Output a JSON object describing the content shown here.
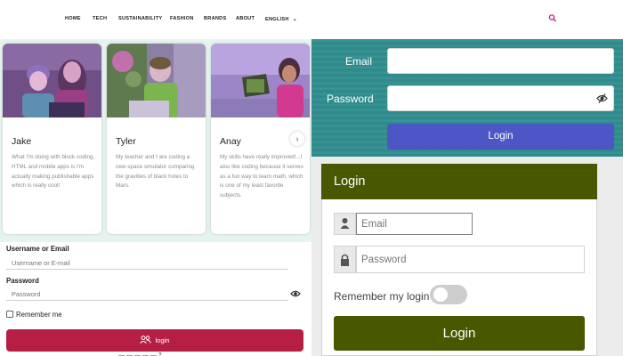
{
  "nav": {
    "links": [
      "HOME",
      "TECH",
      "SUSTAINABILITY",
      "FASHION",
      "BRANDS",
      "ABOUT",
      "ENGLISH"
    ],
    "search_icon": "search-icon",
    "accent_color": "#c0168b"
  },
  "cards": [
    {
      "name": "Jake",
      "quote": "What I'm doing with block coding, HTML and mobile apps is I'm actually making publishable apps which is really cool!"
    },
    {
      "name": "Tyler",
      "quote": "My teacher and I are coding a new space simulator comparing the gravities of black holes to Mars."
    },
    {
      "name": "Anay",
      "quote": "My skills have really improved!...I also like coding because it serves as a fun way to learn math, which is one of my least favorite subjects."
    }
  ],
  "form1": {
    "username_label": "Username or Email",
    "username_placeholder": "Username or E-mail",
    "password_label": "Password",
    "password_placeholder": "Password",
    "remember_label": "Remember me",
    "login_label": "login",
    "footer_partial": "—  —  —  —  —  ?",
    "button_color": "#b51f44"
  },
  "teal_form": {
    "email_label": "Email",
    "password_label": "Password",
    "login_label": "Login",
    "button_color": "#4c56c4"
  },
  "green_form": {
    "title": "Login",
    "email_placeholder": "Email",
    "password_placeholder": "Password",
    "remember_label": "Remember my login",
    "login_label": "Login",
    "brand_color": "#485800"
  }
}
